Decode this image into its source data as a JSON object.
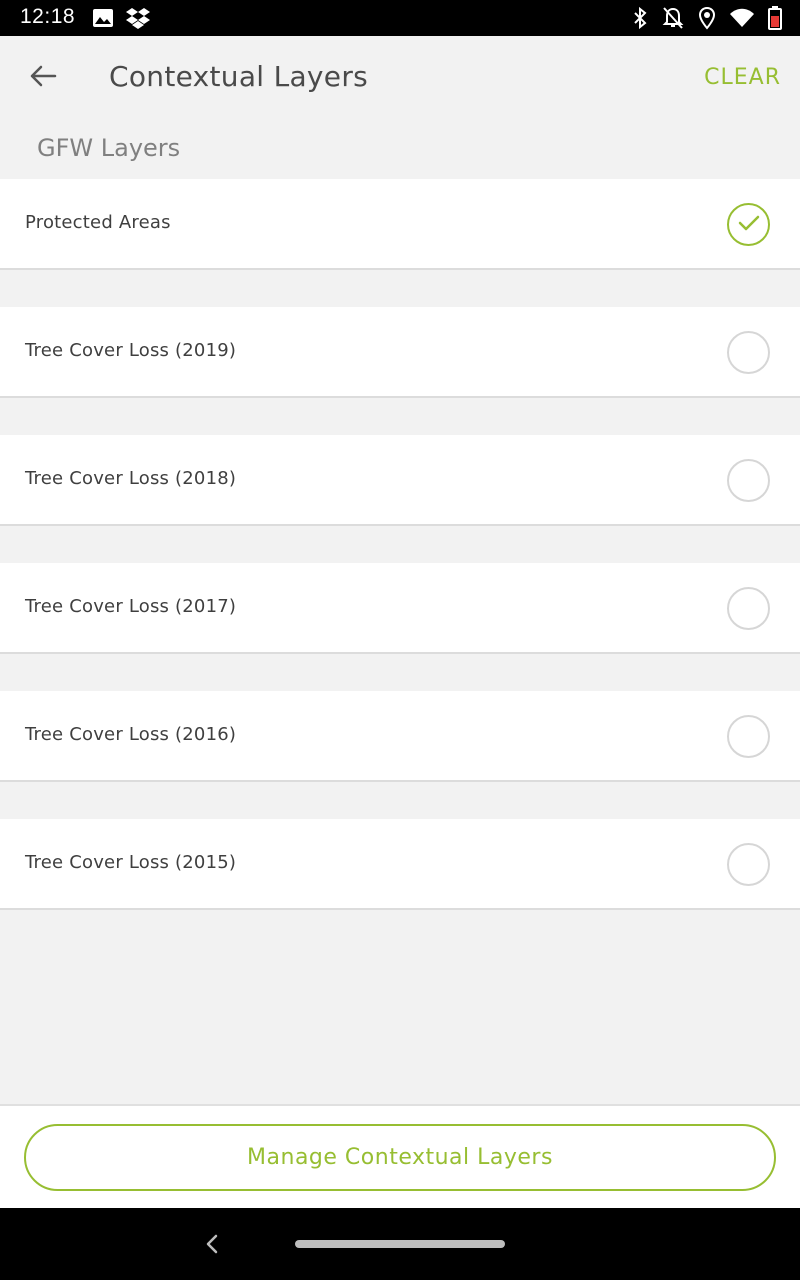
{
  "status_bar": {
    "time": "12:18",
    "left_icons": [
      "image-icon",
      "dropbox-icon"
    ],
    "right_icons": [
      "bluetooth-icon",
      "notifications-off-icon",
      "location-icon",
      "wifi-icon",
      "battery-icon"
    ]
  },
  "app_bar": {
    "title": "Contextual Layers",
    "clear_label": "CLEAR",
    "back_icon": "arrow-back-icon"
  },
  "section": {
    "header": "GFW Layers"
  },
  "layers": [
    {
      "label": "Protected Areas",
      "checked": true
    },
    {
      "label": "Tree Cover Loss (2019)",
      "checked": false
    },
    {
      "label": "Tree Cover Loss (2018)",
      "checked": false
    },
    {
      "label": "Tree Cover Loss (2017)",
      "checked": false
    },
    {
      "label": "Tree Cover Loss (2016)",
      "checked": false
    },
    {
      "label": "Tree Cover Loss (2015)",
      "checked": false
    }
  ],
  "footer": {
    "manage_label": "Manage Contextual Layers"
  },
  "colors": {
    "accent": "#97be32",
    "background": "#f2f2f2",
    "text": "#3f3f3f"
  }
}
